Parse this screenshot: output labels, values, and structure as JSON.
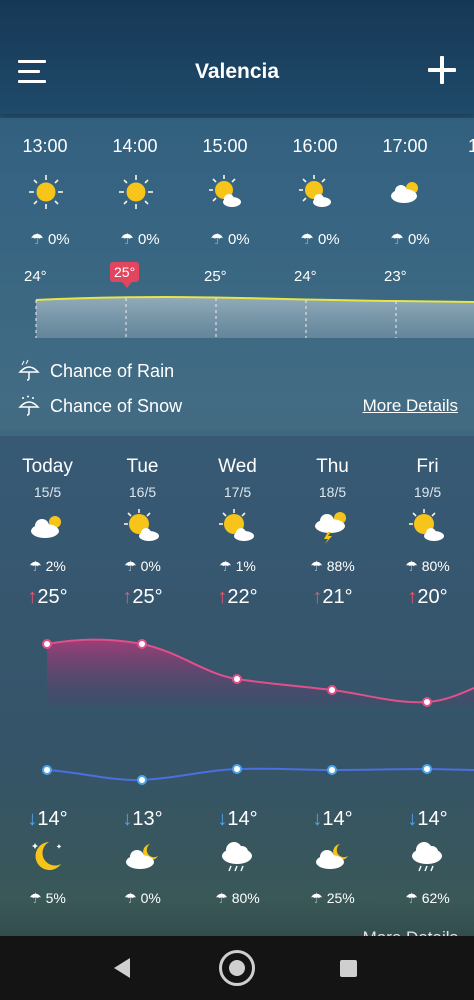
{
  "header": {
    "title": "Valencia"
  },
  "hourly": [
    {
      "time": "13:00",
      "icon": "sun-icon",
      "rain": "0%",
      "temp": "24°"
    },
    {
      "time": "14:00",
      "icon": "sun-icon",
      "rain": "0%",
      "temp": "25°"
    },
    {
      "time": "15:00",
      "icon": "sun-cloud-icon",
      "rain": "0%",
      "temp": "25°"
    },
    {
      "time": "16:00",
      "icon": "sun-cloud-icon",
      "rain": "0%",
      "temp": "24°"
    },
    {
      "time": "17:00",
      "icon": "cloud-sun-icon",
      "rain": "0%",
      "temp": "23°"
    }
  ],
  "hourly_legend": {
    "rain": "Chance of Rain",
    "snow": "Chance of Snow",
    "more": "More Details"
  },
  "daily": [
    {
      "day": "Today",
      "date": "15/5",
      "rain": "2%",
      "high": "25°",
      "low": "14°",
      "night_rain": "5%"
    },
    {
      "day": "Tue",
      "date": "16/5",
      "rain": "0%",
      "high": "25°",
      "low": "13°",
      "night_rain": "0%"
    },
    {
      "day": "Wed",
      "date": "17/5",
      "rain": "1%",
      "high": "22°",
      "low": "14°",
      "night_rain": "80%"
    },
    {
      "day": "Thu",
      "date": "18/5",
      "rain": "88%",
      "high": "21°",
      "low": "14°",
      "night_rain": "25%"
    },
    {
      "day": "Fri",
      "date": "19/5",
      "rain": "80%",
      "high": "20°",
      "low": "14°",
      "night_rain": "62%"
    }
  ],
  "daily_more": "More Details",
  "colors": {
    "high_line": "#e0508a",
    "low_line": "#4b6fe0",
    "highlight_badge": "#e2465f"
  }
}
